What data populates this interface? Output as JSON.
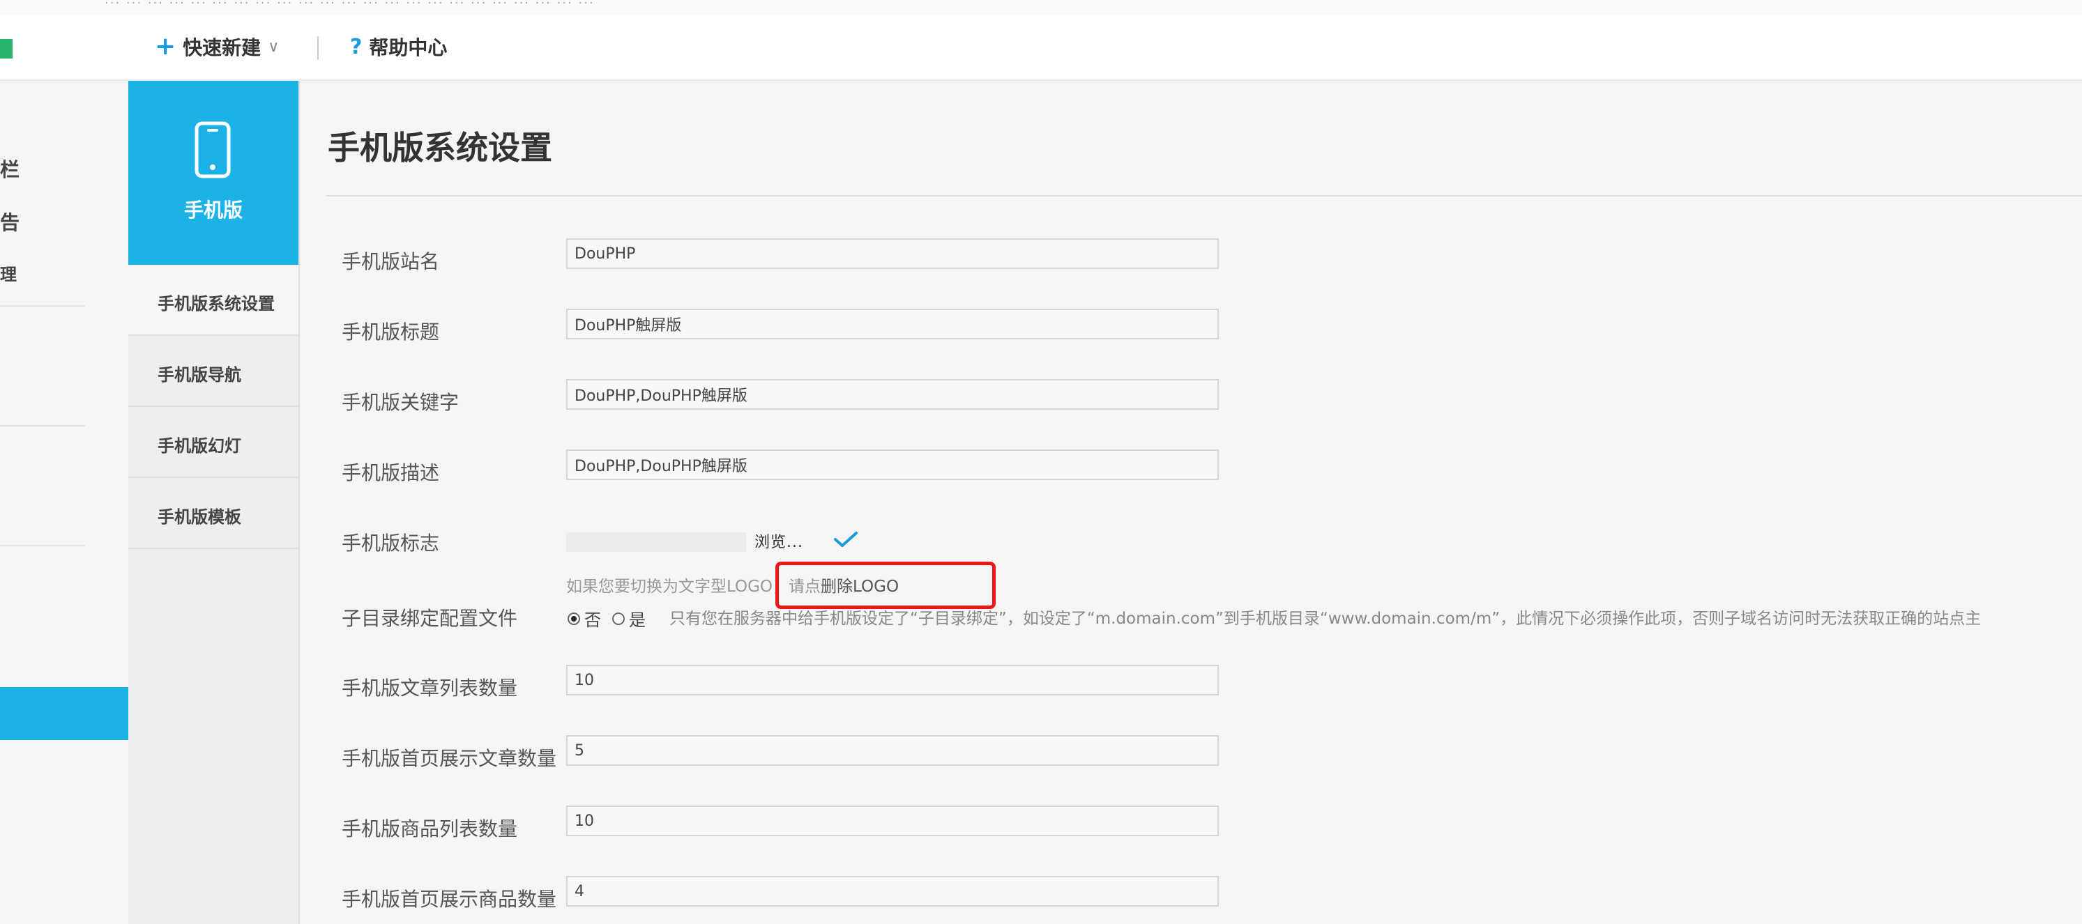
{
  "top_strip": {
    "text": "··· ··· ··· ··· ··· ··· ··· ··· ··· ··· ··· ··· ··· ··· ··· ··· ··· ··· ··· ··· ··· ··· ···"
  },
  "header": {
    "quick_new_label": "快速新建",
    "help_center_label": "帮助中心"
  },
  "outer_sidebar": {
    "items": [
      "栏",
      "告",
      "理"
    ]
  },
  "sub_sidebar": {
    "hero_label": "手机版",
    "items": [
      {
        "label": "手机版系统设置"
      },
      {
        "label": "手机版导航"
      },
      {
        "label": "手机版幻灯"
      },
      {
        "label": "手机版模板"
      }
    ]
  },
  "main": {
    "title": "手机版系统设置",
    "fields": {
      "site_name": {
        "label": "手机版站名",
        "value": "DouPHP"
      },
      "title": {
        "label": "手机版标题",
        "value": "DouPHP触屏版"
      },
      "keywords": {
        "label": "手机版关键字",
        "value": "DouPHP,DouPHP触屏版"
      },
      "description": {
        "label": "手机版描述",
        "value": "DouPHP,DouPHP触屏版"
      },
      "logo": {
        "label": "手机版标志",
        "browse_label": "浏览...",
        "hint_prefix": "如果您要切换为文字型LOGO，请点",
        "delete_link": "删除LOGO"
      },
      "subdir": {
        "label": "子目录绑定配置文件",
        "option_no": "否",
        "option_yes": "是",
        "selected": "否",
        "hint": "只有您在服务器中给手机版设定了“子目录绑定”，如设定了“m.domain.com”到手机版目录“www.domain.com/m”，此情况下必须操作此项，否则子域名访问时无法获取正确的站点主"
      },
      "article_list_count": {
        "label": "手机版文章列表数量",
        "value": "10"
      },
      "home_article_count": {
        "label": "手机版首页展示文章数量",
        "value": "5"
      },
      "product_list_count": {
        "label": "手机版商品列表数量",
        "value": "10"
      },
      "home_product_count": {
        "label": "手机版首页展示商品数量",
        "value": "4"
      }
    }
  },
  "colors": {
    "accent": "#1cb2e8",
    "highlight": "#f21717",
    "check": "#1a9de0"
  }
}
